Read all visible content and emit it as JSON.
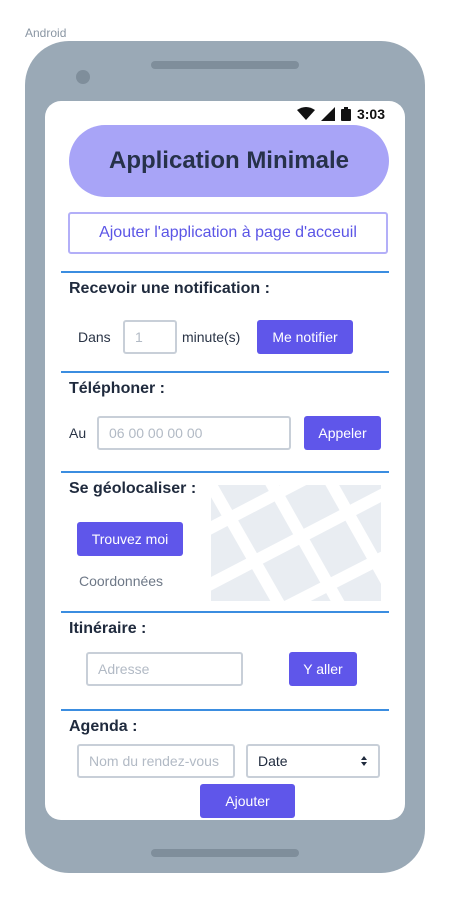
{
  "frame": {
    "label": "Android"
  },
  "statusbar": {
    "time": "3:03"
  },
  "header": {
    "title": "Application Minimale"
  },
  "install": {
    "label": "Ajouter l'application à page d'acceuil"
  },
  "notification": {
    "title": "Recevoir une notification :",
    "prefix": "Dans",
    "minutes_placeholder": "1",
    "unit": "minute(s)",
    "button": "Me notifier"
  },
  "phone": {
    "title": "Téléphoner :",
    "prefix": "Au",
    "placeholder": "06 00 00 00 00",
    "button": "Appeler"
  },
  "geolocation": {
    "title": "Se géolocaliser :",
    "button": "Trouvez moi",
    "coordinates": "Coordonnées"
  },
  "route": {
    "title": "Itinéraire :",
    "placeholder": "Adresse",
    "button": "Y aller"
  },
  "agenda": {
    "title": "Agenda :",
    "placeholder": "Nom du rendez-vous",
    "date_value": "Date",
    "button": "Ajouter"
  },
  "colors": {
    "accent": "#5f56ea",
    "title_pill": "#a8a4f7",
    "divider": "#3b8de0",
    "device": "#9aa9b6"
  }
}
